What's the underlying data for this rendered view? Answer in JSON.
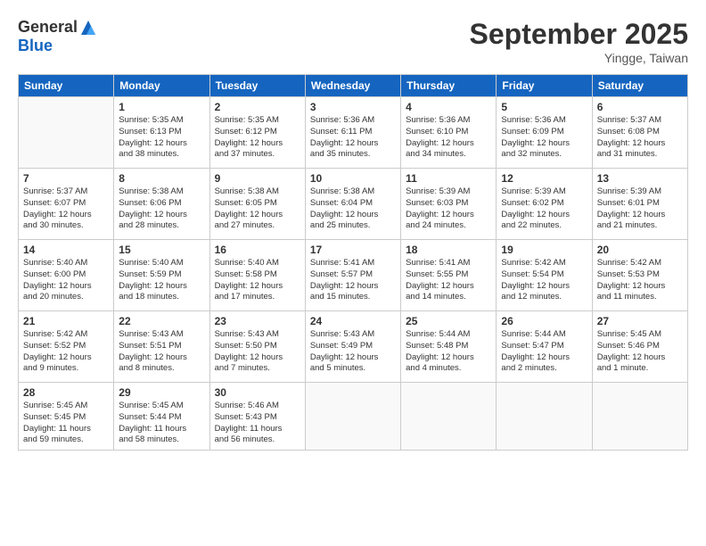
{
  "header": {
    "logo_general": "General",
    "logo_blue": "Blue",
    "month_title": "September 2025",
    "subtitle": "Yingge, Taiwan"
  },
  "weekdays": [
    "Sunday",
    "Monday",
    "Tuesday",
    "Wednesday",
    "Thursday",
    "Friday",
    "Saturday"
  ],
  "weeks": [
    [
      {
        "day": "",
        "info": ""
      },
      {
        "day": "1",
        "info": "Sunrise: 5:35 AM\nSunset: 6:13 PM\nDaylight: 12 hours\nand 38 minutes."
      },
      {
        "day": "2",
        "info": "Sunrise: 5:35 AM\nSunset: 6:12 PM\nDaylight: 12 hours\nand 37 minutes."
      },
      {
        "day": "3",
        "info": "Sunrise: 5:36 AM\nSunset: 6:11 PM\nDaylight: 12 hours\nand 35 minutes."
      },
      {
        "day": "4",
        "info": "Sunrise: 5:36 AM\nSunset: 6:10 PM\nDaylight: 12 hours\nand 34 minutes."
      },
      {
        "day": "5",
        "info": "Sunrise: 5:36 AM\nSunset: 6:09 PM\nDaylight: 12 hours\nand 32 minutes."
      },
      {
        "day": "6",
        "info": "Sunrise: 5:37 AM\nSunset: 6:08 PM\nDaylight: 12 hours\nand 31 minutes."
      }
    ],
    [
      {
        "day": "7",
        "info": "Sunrise: 5:37 AM\nSunset: 6:07 PM\nDaylight: 12 hours\nand 30 minutes."
      },
      {
        "day": "8",
        "info": "Sunrise: 5:38 AM\nSunset: 6:06 PM\nDaylight: 12 hours\nand 28 minutes."
      },
      {
        "day": "9",
        "info": "Sunrise: 5:38 AM\nSunset: 6:05 PM\nDaylight: 12 hours\nand 27 minutes."
      },
      {
        "day": "10",
        "info": "Sunrise: 5:38 AM\nSunset: 6:04 PM\nDaylight: 12 hours\nand 25 minutes."
      },
      {
        "day": "11",
        "info": "Sunrise: 5:39 AM\nSunset: 6:03 PM\nDaylight: 12 hours\nand 24 minutes."
      },
      {
        "day": "12",
        "info": "Sunrise: 5:39 AM\nSunset: 6:02 PM\nDaylight: 12 hours\nand 22 minutes."
      },
      {
        "day": "13",
        "info": "Sunrise: 5:39 AM\nSunset: 6:01 PM\nDaylight: 12 hours\nand 21 minutes."
      }
    ],
    [
      {
        "day": "14",
        "info": "Sunrise: 5:40 AM\nSunset: 6:00 PM\nDaylight: 12 hours\nand 20 minutes."
      },
      {
        "day": "15",
        "info": "Sunrise: 5:40 AM\nSunset: 5:59 PM\nDaylight: 12 hours\nand 18 minutes."
      },
      {
        "day": "16",
        "info": "Sunrise: 5:40 AM\nSunset: 5:58 PM\nDaylight: 12 hours\nand 17 minutes."
      },
      {
        "day": "17",
        "info": "Sunrise: 5:41 AM\nSunset: 5:57 PM\nDaylight: 12 hours\nand 15 minutes."
      },
      {
        "day": "18",
        "info": "Sunrise: 5:41 AM\nSunset: 5:55 PM\nDaylight: 12 hours\nand 14 minutes."
      },
      {
        "day": "19",
        "info": "Sunrise: 5:42 AM\nSunset: 5:54 PM\nDaylight: 12 hours\nand 12 minutes."
      },
      {
        "day": "20",
        "info": "Sunrise: 5:42 AM\nSunset: 5:53 PM\nDaylight: 12 hours\nand 11 minutes."
      }
    ],
    [
      {
        "day": "21",
        "info": "Sunrise: 5:42 AM\nSunset: 5:52 PM\nDaylight: 12 hours\nand 9 minutes."
      },
      {
        "day": "22",
        "info": "Sunrise: 5:43 AM\nSunset: 5:51 PM\nDaylight: 12 hours\nand 8 minutes."
      },
      {
        "day": "23",
        "info": "Sunrise: 5:43 AM\nSunset: 5:50 PM\nDaylight: 12 hours\nand 7 minutes."
      },
      {
        "day": "24",
        "info": "Sunrise: 5:43 AM\nSunset: 5:49 PM\nDaylight: 12 hours\nand 5 minutes."
      },
      {
        "day": "25",
        "info": "Sunrise: 5:44 AM\nSunset: 5:48 PM\nDaylight: 12 hours\nand 4 minutes."
      },
      {
        "day": "26",
        "info": "Sunrise: 5:44 AM\nSunset: 5:47 PM\nDaylight: 12 hours\nand 2 minutes."
      },
      {
        "day": "27",
        "info": "Sunrise: 5:45 AM\nSunset: 5:46 PM\nDaylight: 12 hours\nand 1 minute."
      }
    ],
    [
      {
        "day": "28",
        "info": "Sunrise: 5:45 AM\nSunset: 5:45 PM\nDaylight: 11 hours\nand 59 minutes."
      },
      {
        "day": "29",
        "info": "Sunrise: 5:45 AM\nSunset: 5:44 PM\nDaylight: 11 hours\nand 58 minutes."
      },
      {
        "day": "30",
        "info": "Sunrise: 5:46 AM\nSunset: 5:43 PM\nDaylight: 11 hours\nand 56 minutes."
      },
      {
        "day": "",
        "info": ""
      },
      {
        "day": "",
        "info": ""
      },
      {
        "day": "",
        "info": ""
      },
      {
        "day": "",
        "info": ""
      }
    ]
  ]
}
